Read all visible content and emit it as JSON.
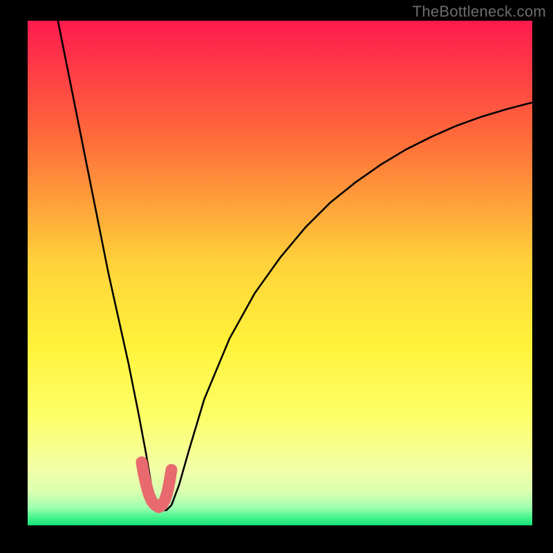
{
  "watermark": "TheBottleneck.com",
  "chart_data": {
    "type": "line",
    "title": "",
    "xlabel": "",
    "ylabel": "",
    "xlim": [
      0,
      100
    ],
    "ylim": [
      0,
      100
    ],
    "grid": false,
    "series": [
      {
        "name": "bottleneck-curve",
        "x": [
          6,
          8,
          10,
          12,
          14,
          16,
          18,
          20,
          22,
          23.5,
          24.5,
          25.5,
          26.5,
          27.5,
          28.5,
          30,
          32,
          35,
          40,
          45,
          50,
          55,
          60,
          65,
          70,
          75,
          80,
          85,
          90,
          95,
          100
        ],
        "y": [
          100,
          90,
          80,
          70,
          60,
          50,
          41,
          32,
          22,
          14,
          8,
          4,
          3,
          3,
          4,
          8,
          15,
          25,
          37,
          46,
          53,
          59,
          64,
          68,
          71.5,
          74.5,
          77,
          79.2,
          81,
          82.5,
          83.8
        ]
      }
    ],
    "highlight": {
      "name": "valley-marker",
      "x": [
        22.6,
        23.0,
        23.5,
        24.0,
        24.6,
        25.3,
        26.0,
        26.6,
        27.2,
        27.7,
        28.1,
        28.5
      ],
      "y": [
        12.5,
        10.2,
        8.0,
        6.2,
        4.8,
        4.0,
        3.6,
        4.0,
        5.0,
        6.6,
        8.6,
        11.0
      ]
    },
    "gradient_bands": [
      {
        "offset": 0.0,
        "color": "#ff1a4f"
      },
      {
        "offset": 0.23,
        "color": "#ff6a3a"
      },
      {
        "offset": 0.48,
        "color": "#ffd23a"
      },
      {
        "offset": 0.64,
        "color": "#fff23a"
      },
      {
        "offset": 0.78,
        "color": "#fdff66"
      },
      {
        "offset": 0.89,
        "color": "#f2ffa8"
      },
      {
        "offset": 0.935,
        "color": "#d8ffb0"
      },
      {
        "offset": 0.965,
        "color": "#9fffb0"
      },
      {
        "offset": 0.985,
        "color": "#42f48a"
      },
      {
        "offset": 1.0,
        "color": "#18e07a"
      }
    ]
  }
}
